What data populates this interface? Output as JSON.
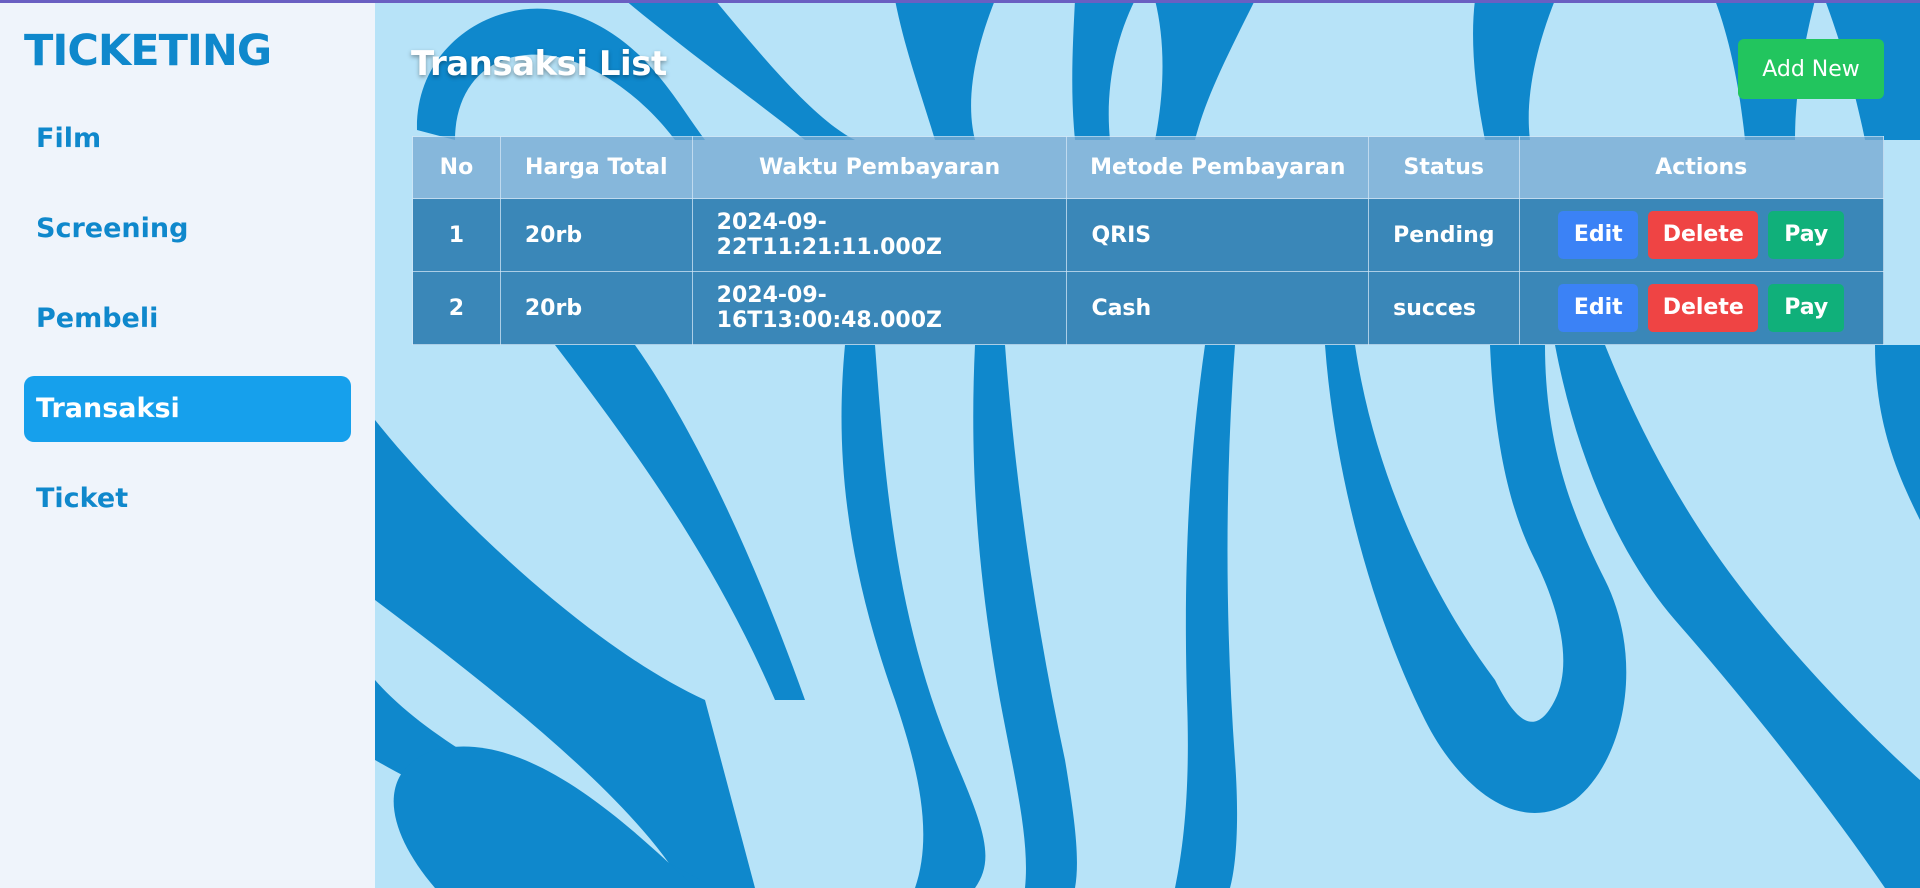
{
  "sidebar": {
    "brand": "TICKETING",
    "items": [
      {
        "label": "Film"
      },
      {
        "label": "Screening"
      },
      {
        "label": "Pembeli"
      },
      {
        "label": "Transaksi"
      },
      {
        "label": "Ticket"
      }
    ],
    "active_item": "Transaksi"
  },
  "main": {
    "title": "Transaksi List",
    "add_button": "Add New",
    "table": {
      "headers": [
        "No",
        "Harga Total",
        "Waktu Pembayaran",
        "Metode Pembayaran",
        "Status",
        "Actions"
      ],
      "rows": [
        {
          "no": "1",
          "harga_total": "20rb",
          "waktu": "2024-09-22T11:21:11.000Z",
          "metode": "QRIS",
          "status": "Pending"
        },
        {
          "no": "2",
          "harga_total": "20rb",
          "waktu": "2024-09-16T13:00:48.000Z",
          "metode": "Cash",
          "status": "succes"
        }
      ],
      "actions": {
        "edit": "Edit",
        "delete": "Delete",
        "pay": "Pay"
      }
    }
  },
  "colors": {
    "brand": "#0f88cc",
    "active_nav": "#16a0ec",
    "add_button": "#22c55e",
    "edit_button": "#3b82f6",
    "delete_button": "#ef4444",
    "pay_button": "#10b07a",
    "background_light": "#b7e3f8",
    "background_dark": "#0f88cc"
  }
}
